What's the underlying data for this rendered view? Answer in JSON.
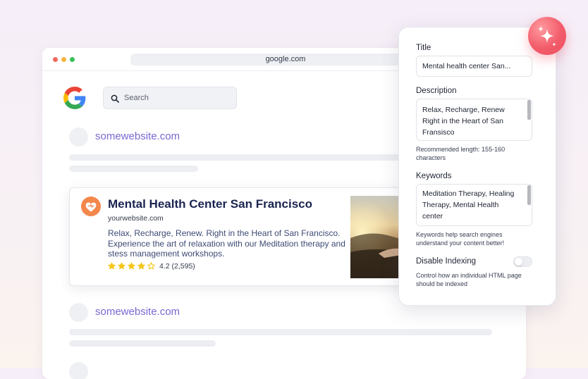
{
  "browser": {
    "url": "google.com"
  },
  "search": {
    "placeholder": "Search"
  },
  "results": {
    "site_link_1": "somewebsite.com",
    "site_link_2": "somewebsite.com"
  },
  "featured": {
    "title": "Mental Health Center San Francisco",
    "url": "yourwebsite.com",
    "description": "Relax, Recharge, Renew. Right in the Heart of San Francisco. Experience the art of relaxation with our Meditation therapy and stess management workshops.",
    "rating_value": 4.2,
    "rating_text": "4.2 (2,595)"
  },
  "seo_panel": {
    "title_label": "Title",
    "title_value": "Mental health center San...",
    "description_label": "Description",
    "description_line1": "Relax, Recharge, Renew",
    "description_line2": "Right in the Heart of San",
    "description_line3": "Fransisco",
    "description_help": "Recommended length: 155-160 characters",
    "keywords_label": "Keywords",
    "keywords_line1": "Meditation Therapy, Healing",
    "keywords_line2": "Therapy, Mental Health",
    "keywords_line3": "center",
    "keywords_help": "Keywords help search engines understand your content better!",
    "disable_indexing_label": "Disable Indexing",
    "disable_indexing_on": false,
    "disable_indexing_help": "Control how an individual HTML page should be indexed"
  },
  "colors": {
    "accent_purple": "#7b68d4",
    "brand_orange": "#f4874b",
    "sparkle_red": "#f25c6a",
    "star_yellow": "#f5c518"
  },
  "icons": {
    "search": "search-icon",
    "google": "google-logo-icon",
    "brand": "heart-brand-icon",
    "sparkle": "sparkle-icon"
  }
}
